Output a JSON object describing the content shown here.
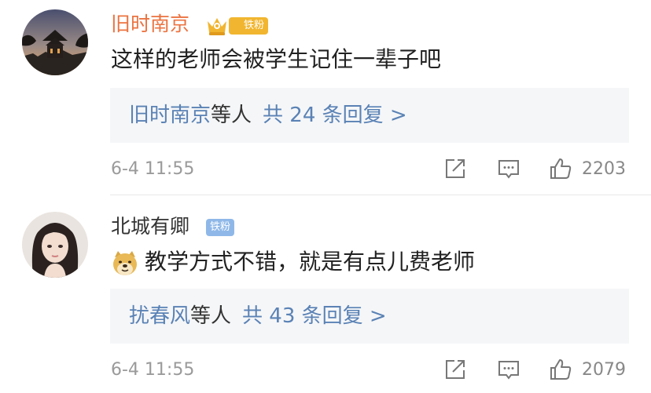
{
  "comments": [
    {
      "username": "旧时南京",
      "badge": "铁粉",
      "text": "这样的老师会被学生记住一辈子吧",
      "replies": {
        "names": "旧时南京",
        "etc": "等人",
        "count_label": "共 24 条回复 >"
      },
      "time": "6-4 11:55",
      "likes": "2203"
    },
    {
      "username": "北城有卿",
      "badge": "铁粉",
      "text": "教学方式不错，就是有点儿费老师",
      "replies": {
        "names": "扰春风",
        "etc": "等人",
        "count_label": "共 43 条回复 >"
      },
      "time": "6-4 11:55",
      "likes": "2079"
    }
  ],
  "icons": [
    "crown-icon",
    "doge-emoji-icon",
    "share-icon",
    "comment-icon",
    "like-icon"
  ],
  "colors": {
    "vip_username": "#eb7340",
    "link_blue": "#5a82b5",
    "gold_badge": "#f1b52f",
    "blue_badge": "#8fb8e8",
    "reply_bg": "#f5f6f8"
  }
}
